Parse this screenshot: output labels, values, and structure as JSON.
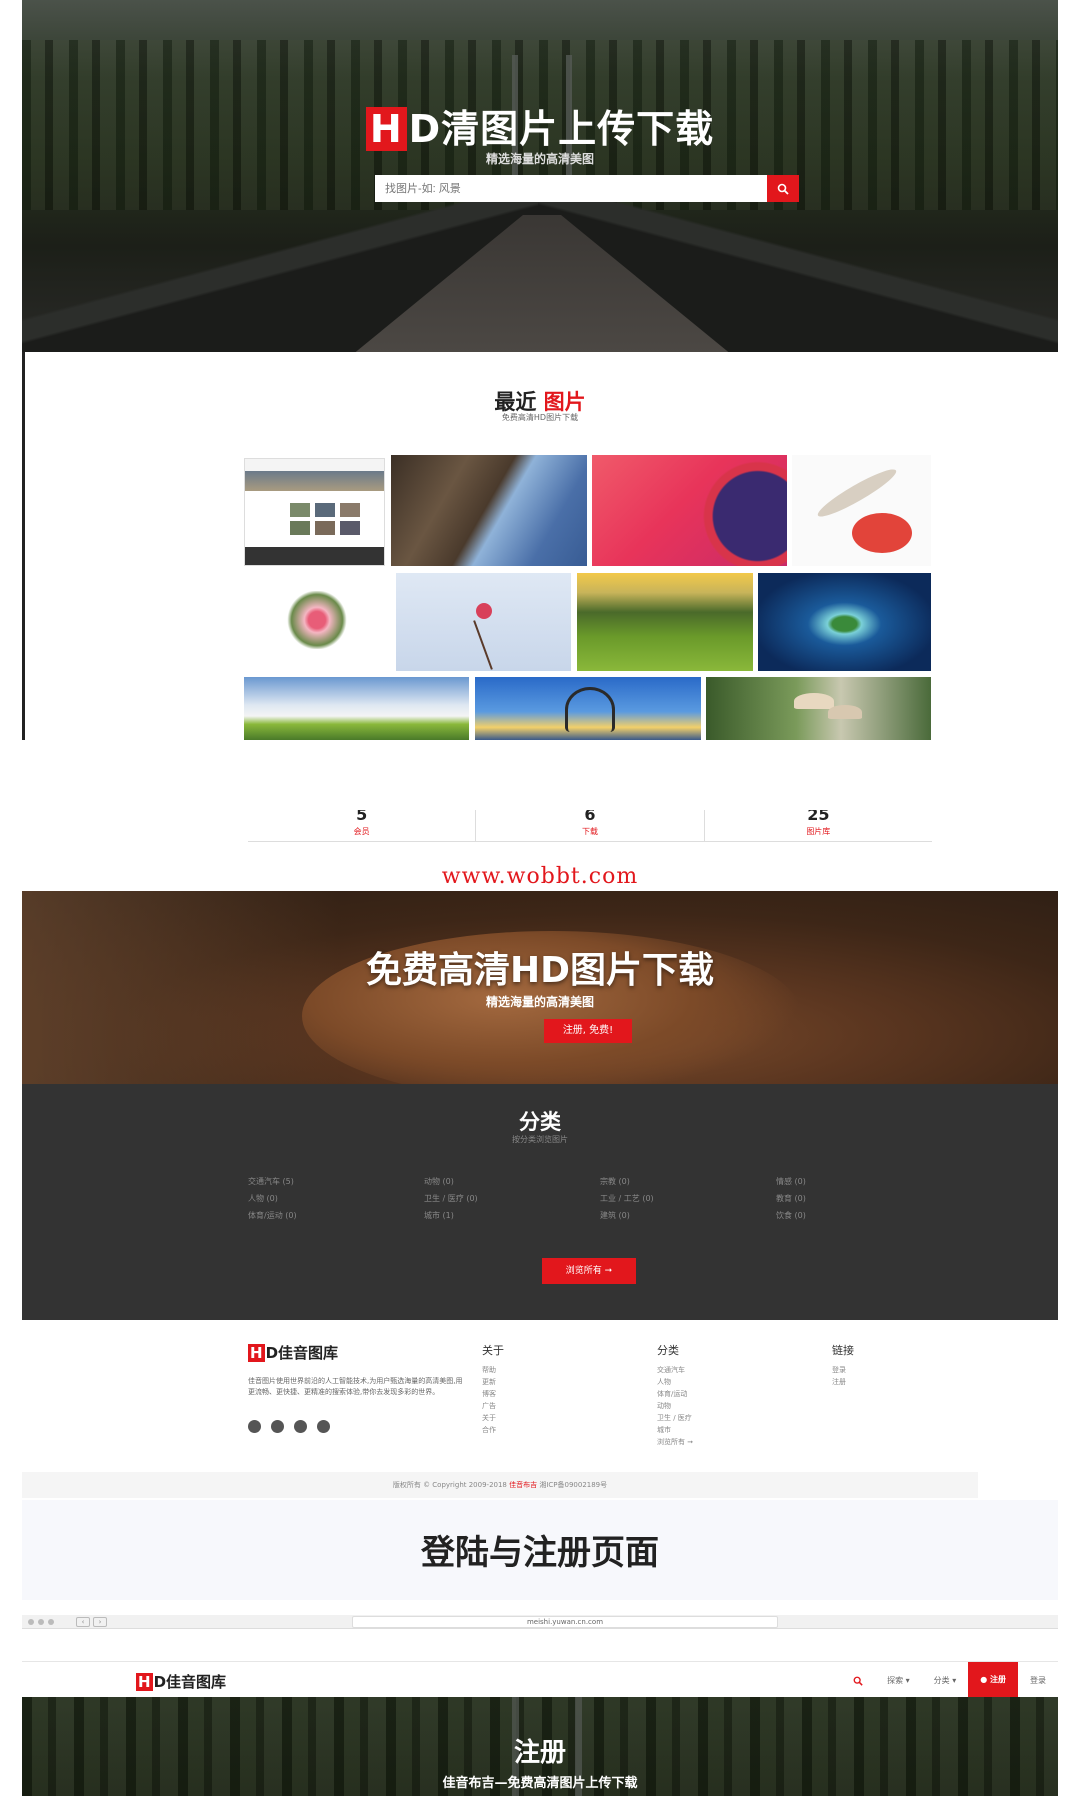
{
  "hero": {
    "title_h": "H",
    "title_rest": "D清图片上传下载",
    "subtitle": "精选海量的高清美图",
    "search_placeholder": "找图片-如: 风景"
  },
  "recent": {
    "title_black": "最近",
    "title_red": "图片",
    "subtitle": "免费高清HD图片下载"
  },
  "stats": [
    {
      "num": "5",
      "label": "会员"
    },
    {
      "num": "6",
      "label": "下载"
    },
    {
      "num": "25",
      "label": "图片库"
    }
  ],
  "watermark": "www.wobbt.com",
  "banner": {
    "title": "免费高清HD图片下载",
    "subtitle": "精选海量的高清美图",
    "button": "注册, 免费!"
  },
  "categories": {
    "title": "分类",
    "subtitle": "按分类浏览图片",
    "items": [
      "交通汽车 (5)",
      "动物 (0)",
      "宗教 (0)",
      "情感 (0)",
      "人物 (0)",
      "卫生 / 医疗 (0)",
      "工业 / 工艺 (0)",
      "教育 (0)",
      "体育/运动 (0)",
      "城市 (1)",
      "建筑 (0)",
      "饮食 (0)"
    ],
    "button": "浏览所有 ➞"
  },
  "footer": {
    "logo_h": "H",
    "logo_rest": "D佳音图库",
    "description": "佳音图片使用世界前沿的人工智能技术,为用户甄选海量的高清美图,用更流畅、更快捷、更精准的搜索体验,带你去发现多彩的世界。",
    "col_about": {
      "heading": "关于",
      "items": [
        "帮助",
        "更新",
        "博客",
        "广告",
        "关于",
        "合作"
      ]
    },
    "col_category": {
      "heading": "分类",
      "items": [
        "交通汽车",
        "人物",
        "体育/运动",
        "动物",
        "卫生 / 医疗",
        "城市",
        "浏览所有 ➞"
      ]
    },
    "col_links": {
      "heading": "链接",
      "items": [
        "登录",
        "注册"
      ]
    },
    "copyright_pre": "版权所有 © Copyright 2009-2018 ",
    "copyright_red": "佳音布吉",
    "copyright_post": " 湘ICP备09002189号"
  },
  "section_label": "登陆与注册页面",
  "browser": {
    "url": "meishi.yuwan.cn.com"
  },
  "nav": {
    "logo_h": "H",
    "logo_rest": "D佳音图库",
    "browse": "探索 ▾",
    "category": "分类 ▾",
    "register": "注册",
    "login": "登录"
  },
  "register_hero": {
    "title": "注册",
    "subtitle": "佳音布吉—免费高清图片上传下载"
  },
  "colors": {
    "accent": "#e2171c",
    "dark": "#333333"
  },
  "icons": [
    "search-icon",
    "user-icon",
    "weibo-icon",
    "wechat-icon",
    "qq-icon"
  ]
}
